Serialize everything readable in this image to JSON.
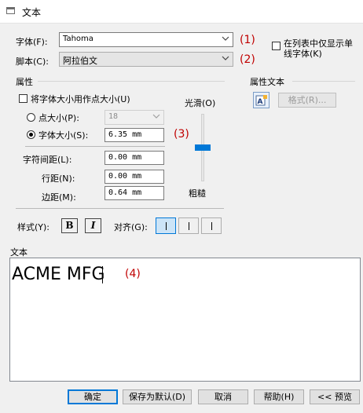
{
  "window": {
    "title": "文本"
  },
  "font": {
    "label": "字体(F):",
    "value": "Tahoma",
    "annotation": "(1)"
  },
  "script": {
    "label": "脚本(C):",
    "value": "阿拉伯文",
    "annotation": "(2)"
  },
  "truetype_only": {
    "label_line1": "在列表中仅显示单",
    "label_line2": "线字体(K)"
  },
  "attributes": {
    "group_label": "属性",
    "use_point_size_label": "将字体大小用作点大小(U)",
    "point_size_label": "点大小(P):",
    "point_size_value": "18",
    "font_size_label": "字体大小(S):",
    "font_size_value": "6.35 mm",
    "font_size_annotation": "(3)",
    "char_spacing_label": "字符间距(L):",
    "char_spacing_value": "0.00 mm",
    "line_spacing_label": "行距(N):",
    "line_spacing_value": "0.00 mm",
    "margin_label": "边距(M):",
    "margin_value": "0.64 mm",
    "smooth_label": "光滑(O)",
    "rough_label": "粗糙",
    "style_label": "样式(Y):",
    "bold_glyph": "B",
    "italic_glyph": "I",
    "align_label": "对齐(G):",
    "align_bar_glyph": "|"
  },
  "attribute_text": {
    "group_label": "属性文本",
    "format_button": "格式(R)..."
  },
  "text": {
    "label": "文本",
    "content": "ACME MFG",
    "annotation": "(4)"
  },
  "buttons": {
    "ok": "确定",
    "save_default": "保存为默认(D)",
    "cancel": "取消",
    "help": "帮助(H)",
    "preview": "<< 预览"
  },
  "colors": {
    "annotation": "#c00000",
    "accent": "#0078d7",
    "slider_thumb": "#0078d7"
  }
}
